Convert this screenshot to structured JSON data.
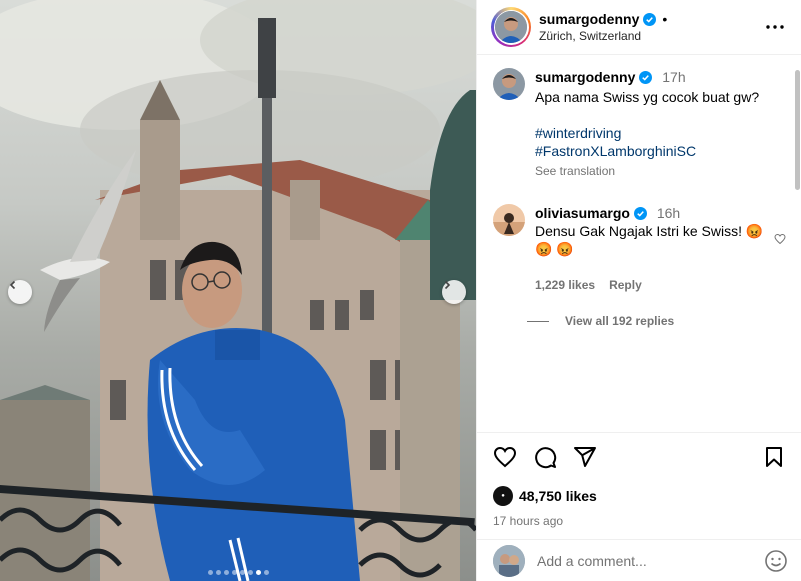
{
  "post": {
    "author": "sumargodenny",
    "location": "Zürich, Switzerland",
    "separator": "•"
  },
  "caption": {
    "username": "sumargodenny",
    "time": "17h",
    "text": "Apa nama Swiss yg cocok buat gw?",
    "hashtags": [
      "#winterdriving",
      "#FastronXLamborghiniSC"
    ],
    "see_translation": "See translation"
  },
  "comment": {
    "username": "oliviasumargo",
    "time": "16h",
    "text": "Densu Gak Ngajak Istri ke Swiss! 😡",
    "second_line": "😡 😡",
    "likes": "1,229 likes",
    "reply": "Reply",
    "view_replies": "View all 192 replies"
  },
  "actions": {
    "likes": "48,750 likes",
    "time_ago": "17 hours ago"
  },
  "add_comment": {
    "placeholder": "Add a comment..."
  },
  "carousel": {
    "dot_count": 8,
    "active_index": 6
  },
  "colors": {
    "link": "#00376b",
    "muted": "#737373",
    "verified": "#0095f6",
    "hoodie": "#1f5fb8"
  },
  "icons": [
    "verified-icon",
    "more-icon",
    "heart-icon",
    "comment-icon",
    "share-icon",
    "bookmark-icon",
    "emoji-icon",
    "chevron-left-icon",
    "chevron-right-icon"
  ]
}
